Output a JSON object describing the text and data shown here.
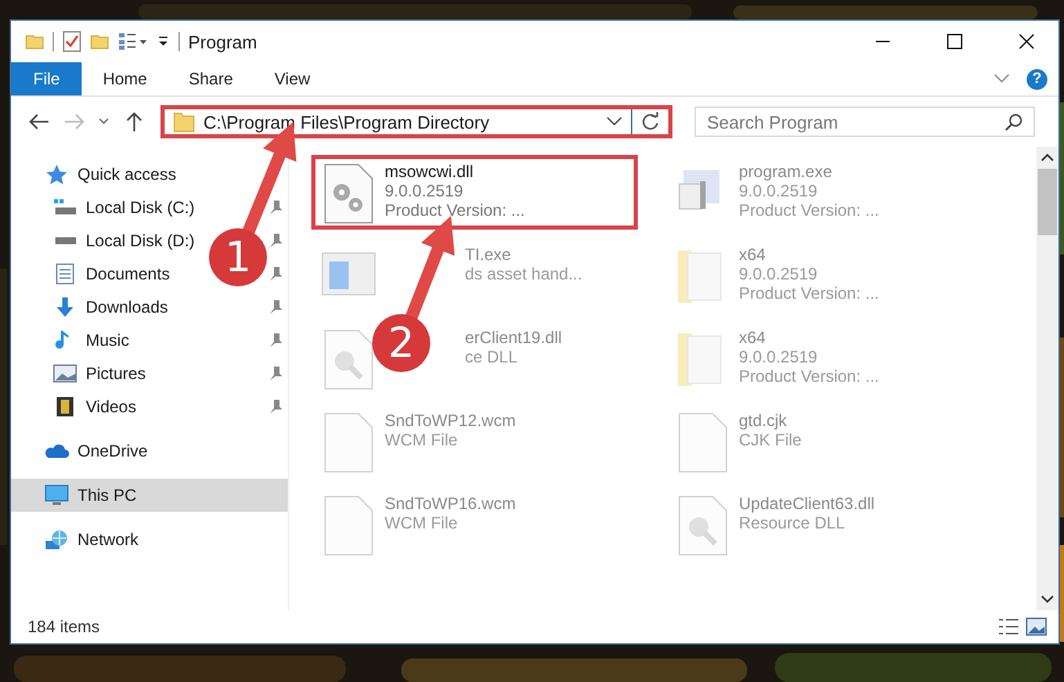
{
  "window": {
    "title": "Program"
  },
  "ribbon": {
    "tabs": [
      {
        "label": "File",
        "selected": true
      },
      {
        "label": "Home",
        "selected": false
      },
      {
        "label": "Share",
        "selected": false
      },
      {
        "label": "View",
        "selected": false
      }
    ],
    "help": "?"
  },
  "address": {
    "path": "C:\\Program Files\\Program Directory",
    "highlighted": true
  },
  "search": {
    "placeholder": "Search Program"
  },
  "sidebar": {
    "items": [
      {
        "label": "Quick access",
        "kind": "star",
        "selected": false,
        "children": [
          {
            "label": "Local Disk (C:)",
            "kind": "drive-c",
            "pinned": true
          },
          {
            "label": "Local Disk (D:)",
            "kind": "drive",
            "pinned": true
          },
          {
            "label": "Documents",
            "kind": "documents",
            "pinned": true
          },
          {
            "label": "Downloads",
            "kind": "downloads",
            "pinned": true
          },
          {
            "label": "Music",
            "kind": "music",
            "pinned": true
          },
          {
            "label": "Pictures",
            "kind": "pictures",
            "pinned": true
          },
          {
            "label": "Videos",
            "kind": "videos",
            "pinned": true
          }
        ]
      },
      {
        "label": "OneDrive",
        "kind": "cloud",
        "selected": false
      },
      {
        "label": "This PC",
        "kind": "pc",
        "selected": true
      },
      {
        "label": "Network",
        "kind": "network",
        "selected": false
      }
    ]
  },
  "files": [
    {
      "kind": "settings",
      "name": "msowcwi.dll",
      "lines": [
        "9.0.0.2519",
        "Product Version:    ..."
      ],
      "highlighted": true
    },
    {
      "kind": "app",
      "name": "program.exe",
      "lines": [
        "9.0.0.2519",
        "Product Version:    ..."
      ],
      "highlighted": false
    },
    {
      "kind": "window",
      "name": "TI.exe",
      "lines": [
        "ds asset hand..."
      ],
      "highlighted": false,
      "under_arrow": true
    },
    {
      "kind": "folder",
      "name": "x64",
      "lines": [
        "9.0.0.2519",
        "Product Version:    ..."
      ],
      "highlighted": false
    },
    {
      "kind": "resource",
      "name": "erClient19.dll",
      "lines": [
        "ce DLL"
      ],
      "highlighted": false,
      "under_arrow": true
    },
    {
      "kind": "folder",
      "name": "x64",
      "lines": [
        "9.0.0.2519",
        "Product Version:    ..."
      ],
      "highlighted": false
    },
    {
      "kind": "blank",
      "name": "SndToWP12.wcm",
      "lines": [
        "WCM File"
      ],
      "highlighted": false
    },
    {
      "kind": "blank",
      "name": "gtd.cjk",
      "lines": [
        "CJK File"
      ],
      "highlighted": false
    },
    {
      "kind": "blank",
      "name": "SndToWP16.wcm",
      "lines": [
        "WCM File"
      ],
      "highlighted": false
    },
    {
      "kind": "resource",
      "name": "UpdateClient63.dll",
      "lines": [
        "Resource DLL"
      ],
      "highlighted": false
    }
  ],
  "status_bar": {
    "count": "184 items"
  },
  "callouts": [
    {
      "number": "1"
    },
    {
      "number": "2"
    }
  ]
}
